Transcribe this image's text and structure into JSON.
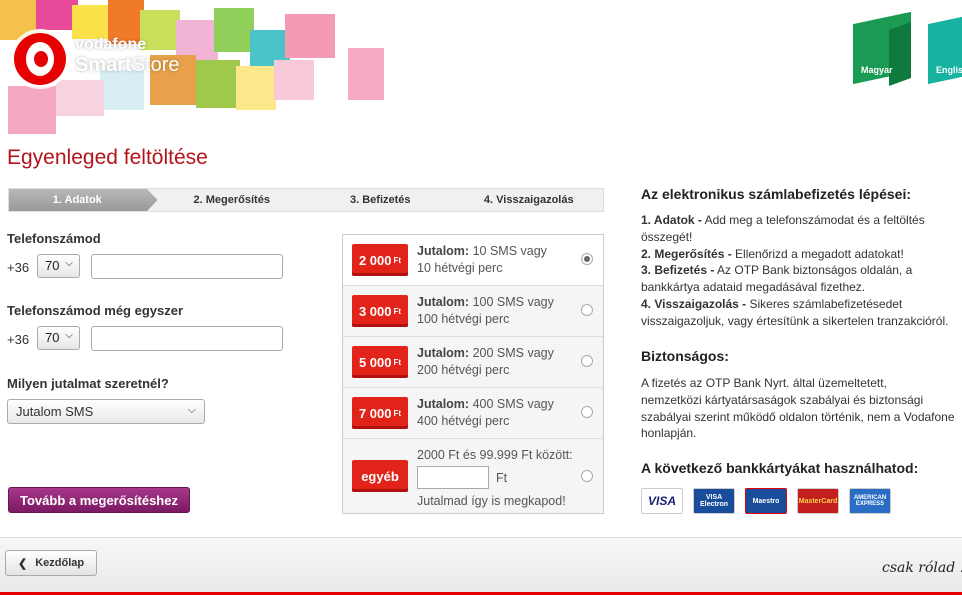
{
  "header": {
    "logo_line1": "vodafone",
    "logo_line2_bold": "Smart",
    "logo_line2_rest": "Store",
    "languages": [
      "Magyar",
      "English"
    ]
  },
  "title": "Egyenleged feltöltése",
  "steps": [
    "1. Adatok",
    "2. Megerősítés",
    "3. Befizetés",
    "4. Visszaigazolás"
  ],
  "form": {
    "phone_label": "Telefonszámod",
    "phone_again_label": "Telefonszámod még egyszer",
    "country_prefix": "+36",
    "area_code": "70",
    "reward_label": "Milyen jutalmat szeretnél?",
    "reward_value": "Jutalom SMS",
    "next_button": "Tovább a megerősítéshez"
  },
  "offers": [
    {
      "amount": "2 000",
      "currency": "Ft",
      "reward_label": "Jutalom:",
      "line1": " 10 SMS vagy",
      "line2": "10 hétvégi perc",
      "selected": true
    },
    {
      "amount": "3 000",
      "currency": "Ft",
      "reward_label": "Jutalom:",
      "line1": " 100 SMS vagy",
      "line2": "100 hétvégi perc",
      "selected": false
    },
    {
      "amount": "5 000",
      "currency": "Ft",
      "reward_label": "Jutalom:",
      "line1": " 200 SMS vagy",
      "line2": "200 hétvégi perc",
      "selected": false
    },
    {
      "amount": "7 000",
      "currency": "Ft",
      "reward_label": "Jutalom:",
      "line1": " 400 SMS vagy",
      "line2": "400 hétvégi perc",
      "selected": false
    }
  ],
  "custom_offer": {
    "badge": "egyéb",
    "range_text": "2000 Ft és 99.999 Ft között:",
    "unit": "Ft",
    "footer_text": "Jutalmad így is megkapod!"
  },
  "info": {
    "steps_heading": "Az elektronikus számlabefizetés lépései:",
    "step1_bold": "1. Adatok -",
    "step1_line1": " Add meg a telefonszámodat és a feltöltés",
    "step1_line2": "összegét!",
    "step2_bold": "2. Megerősítés -",
    "step2_text": " Ellenőrizd a megadott adatokat!",
    "step3_bold": "3. Befizetés -",
    "step3_line1": " Az OTP Bank biztonságos oldalán, a",
    "step3_line2": "bankkártya adataid megadásával fizethez.",
    "step4_bold": "4. Visszaigazolás -",
    "step4_line1": " Sikeres számlabefizetésedet",
    "step4_line2": "visszaigazoljuk, vagy értesítünk a sikertelen tranzakcióról.",
    "security_heading": "Biztonságos:",
    "security_line1": "A fizetés az OTP Bank Nyrt. által üzemeltetett,",
    "security_line2": "nemzetközi kártyatársaságok szabályai és biztonsági",
    "security_line3": "szabályai szerint működő oldalon történik, nem a Vodafone",
    "security_line4": "honlapján.",
    "cards_heading": "A következő bankkártyákat használhatod:",
    "cards": [
      "VISA",
      "VISA Electron",
      "Maestro",
      "MasterCard",
      "AMERICAN EXPRESS"
    ]
  },
  "footer": {
    "home_button": "Kezdőlap",
    "slogan": "csak rólad ."
  },
  "colors": {
    "brand_red": "#e60000",
    "title_red": "#b3141b",
    "button_purple": "#8e2575"
  }
}
